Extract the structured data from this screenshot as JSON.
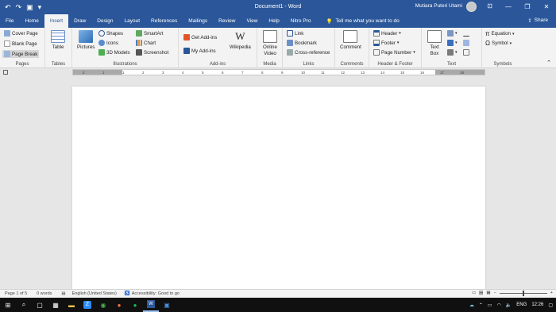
{
  "titlebar": {
    "doc_title": "Document1 - Word",
    "user_name": "Mutiara Puteri Utami",
    "qat": [
      "undo-icon",
      "redo-icon",
      "save-icon",
      "customize-icon"
    ]
  },
  "tabs": [
    "File",
    "Home",
    "Insert",
    "Draw",
    "Design",
    "Layout",
    "References",
    "Mailings",
    "Review",
    "View",
    "Help",
    "Nitro Pro"
  ],
  "active_tab": "Insert",
  "tellme": "Tell me what you want to do",
  "share": "Share",
  "groups": {
    "pages": {
      "label": "Pages",
      "items": [
        "Cover Page",
        "Blank Page",
        "Page Break"
      ]
    },
    "tables": {
      "label": "Tables",
      "table": "Table"
    },
    "illustrations": {
      "label": "Illustrations",
      "pictures": "Pictures",
      "items_a": [
        "Shapes",
        "Icons",
        "3D Models"
      ],
      "items_b": [
        "SmartArt",
        "Chart",
        "Screenshot"
      ]
    },
    "addins": {
      "label": "Add-ins",
      "get": "Get Add-ins",
      "my": "My Add-ins",
      "wikipedia": "Wikipedia"
    },
    "media": {
      "label": "Media",
      "video": "Online Video"
    },
    "links": {
      "label": "Links",
      "items": [
        "Link",
        "Bookmark",
        "Cross-reference"
      ]
    },
    "comments": {
      "label": "Comments",
      "comment": "Comment"
    },
    "header_footer": {
      "label": "Header & Footer",
      "items": [
        "Header",
        "Footer",
        "Page Number"
      ]
    },
    "text": {
      "label": "Text",
      "textbox": "Text Box"
    },
    "symbols": {
      "label": "Symbols",
      "items": [
        "Equation",
        "Symbol"
      ]
    }
  },
  "ruler_ticks": [
    "2",
    "1",
    "1",
    "2",
    "3",
    "4",
    "5",
    "6",
    "7",
    "8",
    "9",
    "10",
    "11",
    "12",
    "13",
    "14",
    "15",
    "16",
    "17",
    "18"
  ],
  "status": {
    "page": "Page 1 of 5",
    "words": "0 words",
    "language": "English (United States)",
    "accessibility": "Accessibility: Good to go"
  },
  "tray": {
    "lang": "ENG",
    "time": "12:26"
  },
  "colors": {
    "word_blue": "#2b579a"
  }
}
